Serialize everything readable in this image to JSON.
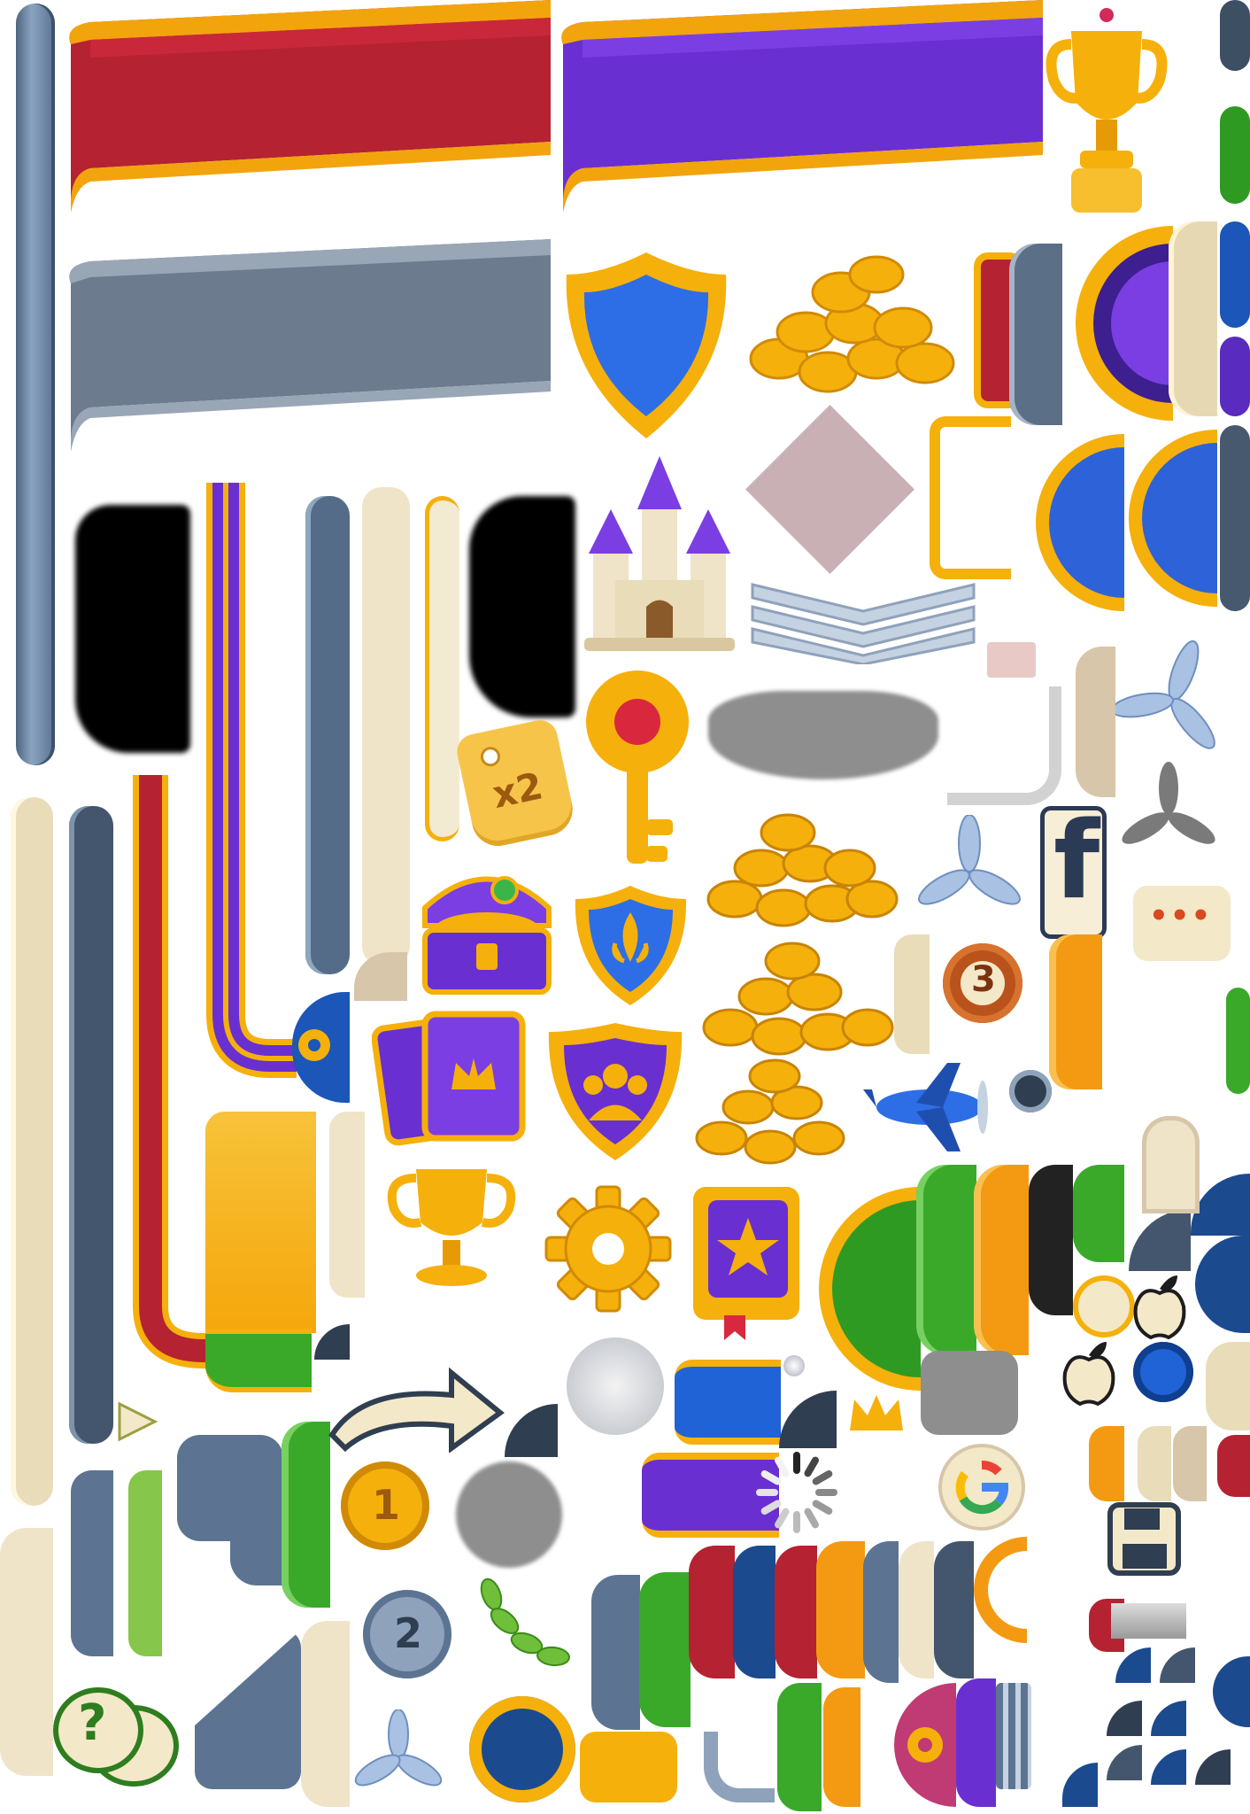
{
  "sheet": {
    "badge_x2": "x2",
    "medal_1": "1",
    "medal_2": "2",
    "medal_3": "3",
    "facebook_letter": "f",
    "help_glyph": "?",
    "chat_dots": "•••"
  },
  "icons": [
    "banner-red-icon",
    "banner-purple-icon",
    "banner-gray-icon",
    "trophy-icon",
    "shield-blue-icon",
    "coin-pile-icon",
    "castle-icon",
    "key-icon",
    "treasure-chest-icon",
    "fleur-de-lis-shield-icon",
    "cards-icon",
    "team-shield-icon",
    "gear-icon",
    "star-book-icon",
    "airplane-icon",
    "propeller-icon",
    "apple-icon",
    "google-icon",
    "floppy-disk-icon",
    "crown-icon",
    "laurel-icon",
    "arrow-icon",
    "spinner-icon",
    "facebook-icon",
    "chat-bubble-icon",
    "help-bubble-icon"
  ],
  "colors": {
    "red": "#b52231",
    "purple": "#6a2fd1",
    "gold": "#f5b00b",
    "slate": "#5d7590",
    "cream": "#efe4c8",
    "green": "#3aa92a",
    "blue": "#1f63d6",
    "orange": "#f39a12"
  }
}
